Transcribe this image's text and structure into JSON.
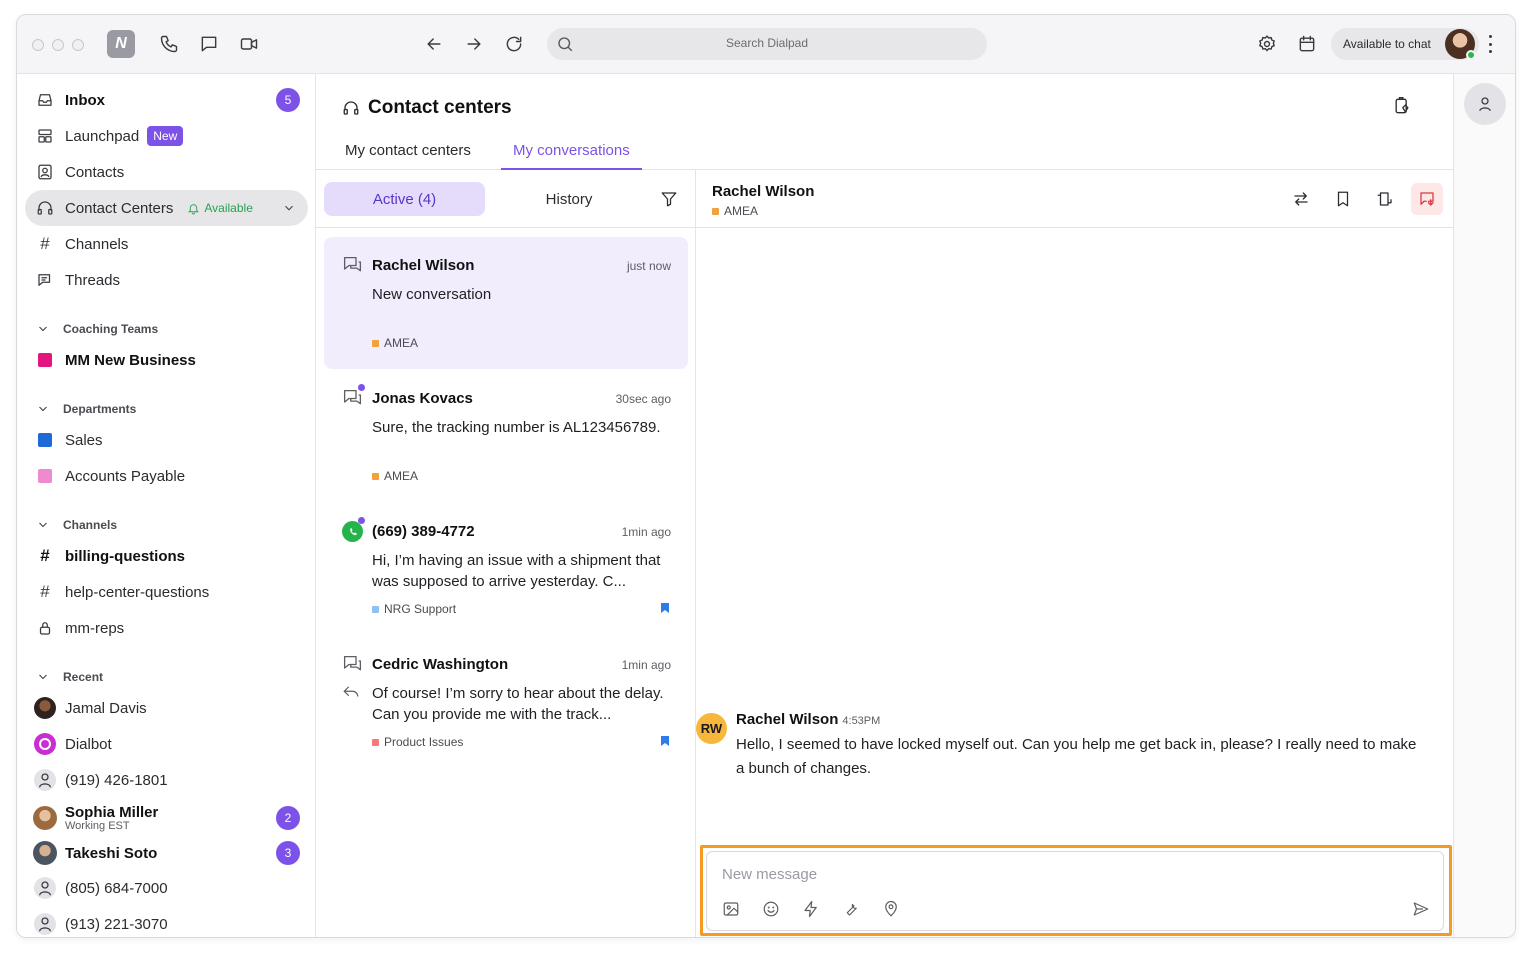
{
  "topbar": {
    "search_placeholder": "Search Dialpad",
    "status": "Available to chat",
    "logo": "N"
  },
  "sidebar": {
    "inbox": {
      "label": "Inbox",
      "count": "5"
    },
    "launchpad": {
      "label": "Launchpad",
      "badge": "New"
    },
    "contacts": {
      "label": "Contacts"
    },
    "contact_centers": {
      "label": "Contact Centers",
      "status": "Available"
    },
    "channels_item": {
      "label": "Channels"
    },
    "threads": {
      "label": "Threads"
    },
    "coaching": {
      "header": "Coaching Teams",
      "items": [
        {
          "label": "MM New Business",
          "color": "#e5157f"
        }
      ]
    },
    "departments": {
      "header": "Departments",
      "items": [
        {
          "label": "Sales",
          "color": "#1e6ad6"
        },
        {
          "label": "Accounts Payable",
          "color": "#f08ad0"
        }
      ]
    },
    "channels": {
      "header": "Channels",
      "items": [
        {
          "label": "billing-questions"
        },
        {
          "label": "help-center-questions"
        },
        {
          "label": "mm-reps"
        }
      ]
    },
    "recent": {
      "header": "Recent",
      "items": [
        {
          "label": "Jamal Davis"
        },
        {
          "label": "Dialbot"
        },
        {
          "label": "(919) 426-1801"
        },
        {
          "label": "Sophia Miller",
          "sub": "Working EST",
          "count": "2"
        },
        {
          "label": "Takeshi Soto",
          "count": "3"
        },
        {
          "label": "(805) 684-7000"
        },
        {
          "label": "(913) 221-3070"
        }
      ]
    }
  },
  "main": {
    "title": "Contact centers",
    "tabs": [
      {
        "label": "My contact centers"
      },
      {
        "label": "My conversations"
      }
    ],
    "filters": {
      "active": "Active (4)",
      "history": "History"
    },
    "conversations": [
      {
        "name": "Rachel Wilson",
        "time": "just now",
        "message": "New conversation",
        "tag": "AMEA",
        "tag_color": "#f2a23c"
      },
      {
        "name": "Jonas Kovacs",
        "time": "30sec ago",
        "message": "Sure, the tracking number is AL123456789.",
        "tag": "AMEA",
        "tag_color": "#f2a23c"
      },
      {
        "name": "(669) 389-4772",
        "time": "1min ago",
        "message": "Hi, I’m having an issue with a shipment that was supposed to arrive yesterday. C...",
        "tag": "NRG Support",
        "tag_color": "#8ec3f0"
      },
      {
        "name": "Cedric Washington",
        "time": "1min ago",
        "message": "Of course! I’m sorry to hear about the delay. Can you provide me with the track...",
        "tag": "Product Issues",
        "tag_color": "#f07b7b"
      }
    ]
  },
  "chat": {
    "contact_name": "Rachel Wilson",
    "contact_tag": "AMEA",
    "message": {
      "initials": "RW",
      "author": "Rachel Wilson",
      "time": "4:53PM",
      "text": "Hello, I seemed to have locked myself out. Can you help me get back in, please? I really need to make a bunch of changes."
    },
    "composer_placeholder": "New message"
  },
  "colors": {
    "accent": "#7c52e8",
    "highlight": "#f59a23",
    "available": "#27a24f"
  }
}
